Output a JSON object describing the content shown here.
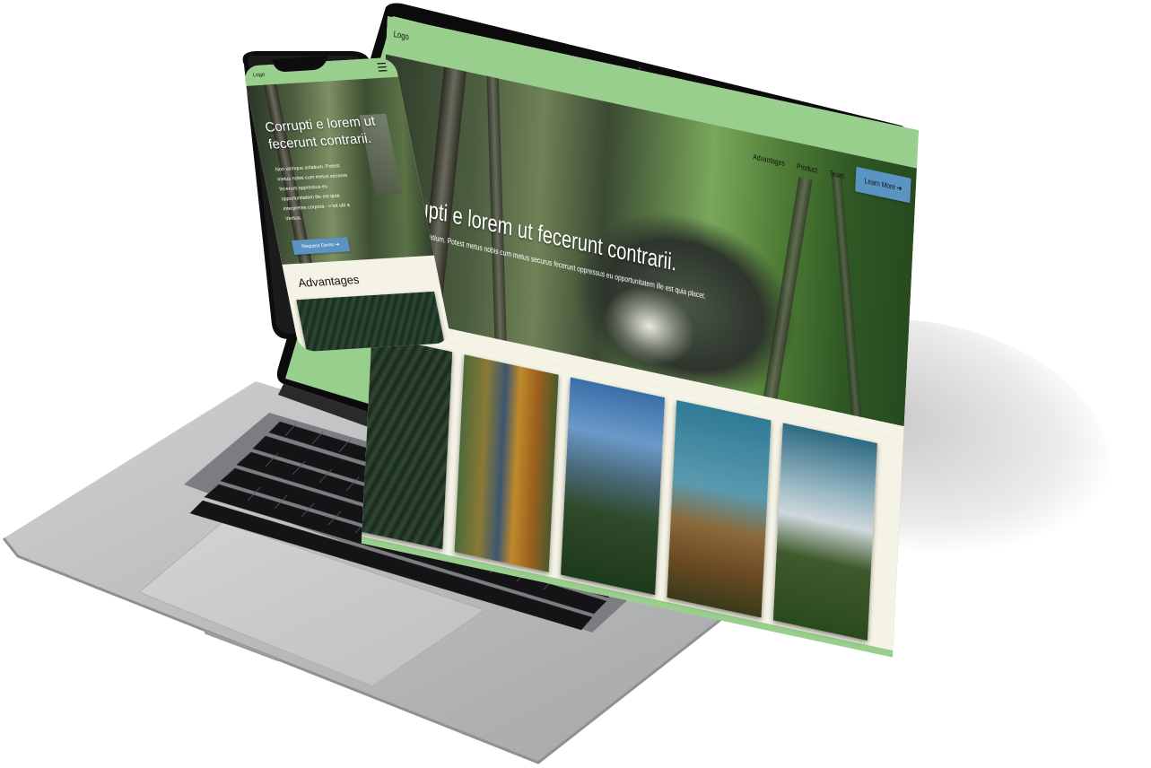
{
  "site": {
    "logo": "Logo",
    "nav": [
      "Advantages",
      "Product",
      "Team"
    ],
    "cta": "Learn More ➔",
    "hero_title": "Corrupti e lorem ut fecerunt contrarii.",
    "hero_sub": "Non utrinque solatium. Potest metus nobis cum metus securus fecerunt oppressus eu opportunitatem ille est quia placet."
  },
  "phone": {
    "logo": "Logo",
    "menu_icon": "hamburger-icon",
    "hero_title": "Corrupti e lorem ut fecerunt contrarii.",
    "hero_sub": "Non utrinque solatium. Potest metus nobis cum metus securus fecerunt oppressus eu opportunitatem ille est quia interpretes corpora - v tot ubi a Veritus.",
    "cta": "Request Demo ➔",
    "section_heading": "Advantages"
  },
  "colors": {
    "nav_green": "#98cf8d",
    "cream": "#f4f3e5",
    "button_blue": "#5b93c2"
  }
}
